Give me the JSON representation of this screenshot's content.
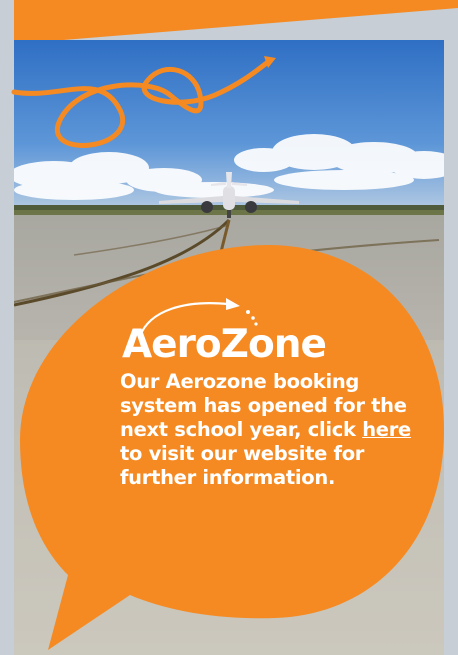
{
  "brand": {
    "logo_text": "AeroZone",
    "accent_color": "#f58a22",
    "text_color": "#ffffff"
  },
  "message": {
    "before_link": "Our Aerozone booking system has opened for the next school year, click ",
    "link_text": "here",
    "after_link": " to visit our website for further information."
  },
  "icons": {
    "logo_arrow": "curved-arrow-icon",
    "squiggle": "flight-path-squiggle"
  }
}
